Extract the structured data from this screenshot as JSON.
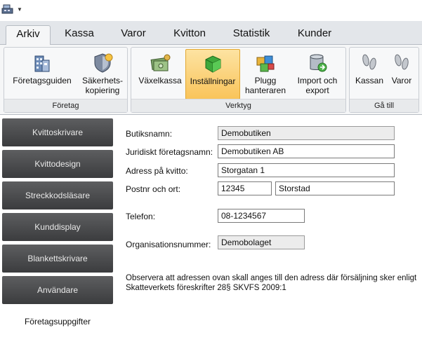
{
  "tabs": [
    "Arkiv",
    "Kassa",
    "Varor",
    "Kvitton",
    "Statistik",
    "Kunder"
  ],
  "ribbon": {
    "groups": {
      "foretag": "Företag",
      "verktyg": "Verktyg",
      "gatill": "Gå till"
    },
    "buttons": {
      "foretagsguiden": "Företagsguiden",
      "sakerhet_1": "Säkerhets-",
      "sakerhet_2": "kopiering",
      "vaxelkassa": "Växelkassa",
      "installningar": "Inställningar",
      "plugg_1": "Plugg",
      "plugg_2": "hanteraren",
      "import_1": "Import och",
      "import_2": "export",
      "kassan": "Kassan",
      "varor": "Varor"
    }
  },
  "sidebar": {
    "items": [
      "Kvittoskrivare",
      "Kvittodesign",
      "Streckkodsläsare",
      "Kunddisplay",
      "Blankettskrivare",
      "Användare",
      "Företagsuppgifter"
    ],
    "active": "Företagsuppgifter"
  },
  "form": {
    "butiksnamn_label": "Butiksnamn:",
    "butiksnamn": "Demobutiken",
    "juridiskt_label": "Juridiskt företagsnamn:",
    "juridiskt": "Demobutiken AB",
    "adress_label": "Adress på kvitto:",
    "adress": "Storgatan 1",
    "postnr_label": "Postnr och ort:",
    "postnr": "12345",
    "ort": "Storstad",
    "telefon_label": "Telefon:",
    "telefon": "08-1234567",
    "orgnr_label": "Organisationsnummer:",
    "orgnr": "Demobolaget"
  },
  "note": {
    "line1": "Observera att adressen ovan skall anges till den adress där försäljning sker enligt",
    "line2": "Skatteverkets föreskrifter 28§ SKVFS 2009:1"
  },
  "colors": {
    "accent_active": "#f9c45a",
    "sidebar_bg": "#4a4b4d"
  }
}
